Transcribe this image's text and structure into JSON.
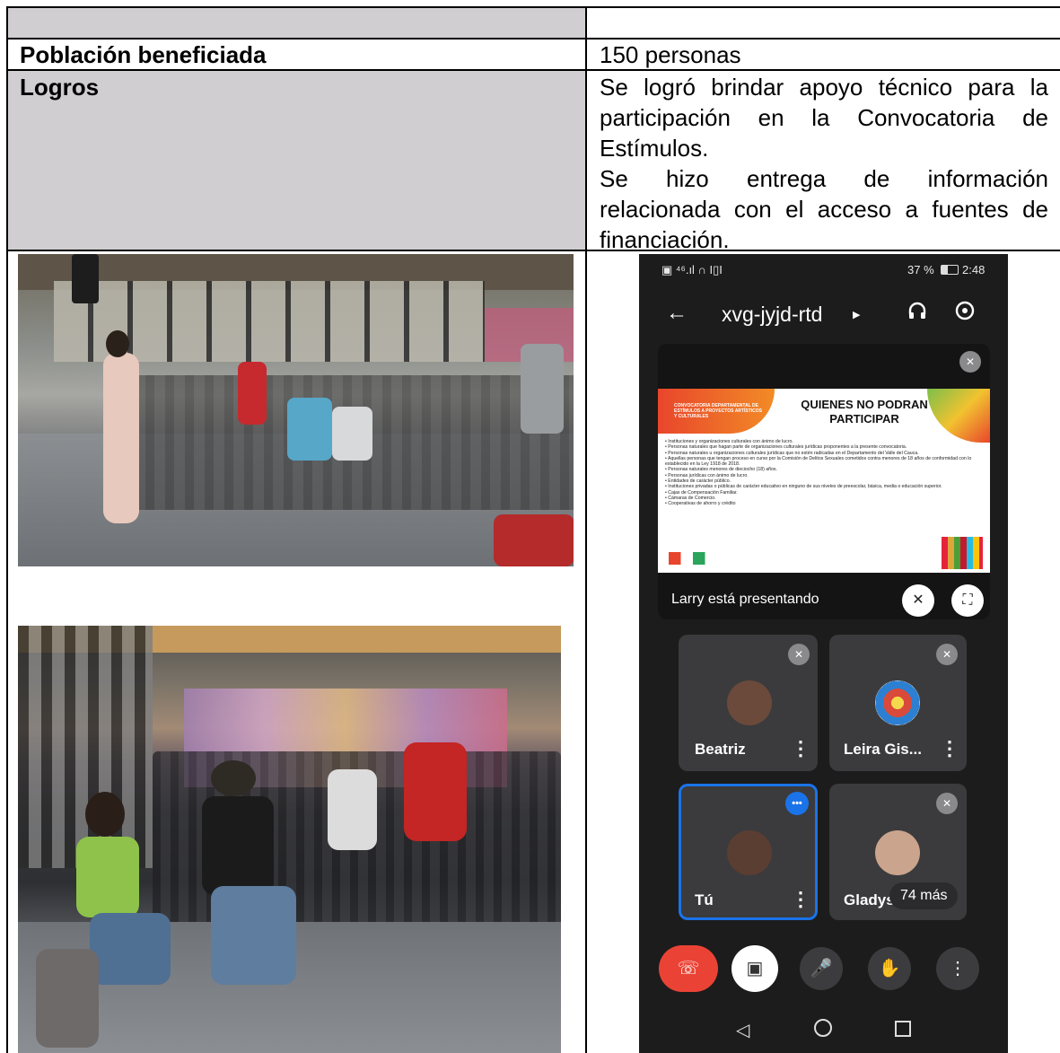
{
  "table": {
    "row1": {
      "label": "Población beneficiada",
      "value": "150 personas"
    },
    "row2": {
      "label": "Logros",
      "paragraph1": "Se logró brindar apoyo técnico para la participación en la Convocatoria de Estímulos.",
      "paragraph2": "Se hizo entrega de información relacionada con el acceso a fuentes de financiación."
    },
    "header_fill_color": "#d0ced0"
  },
  "meet_screenshot": {
    "status_bar": {
      "left": "▣ ⁴⁶.ıl ∩ I▯I",
      "battery": "37 %",
      "time": "2:48"
    },
    "meeting_code": "xvg-jyjd-rtd",
    "slide": {
      "header": "CONVOCATORIA DEPARTAMENTAL DE ESTÍMULOS A PROYECTOS ARTÍSTICOS Y CULTURALES",
      "title": "QUIENES NO PODRAN PARTICIPAR",
      "items": [
        "Instituciones y organizaciones culturales con ánimo de lucro.",
        "Personas naturales que hagan parte de organizaciones culturales jurídicas proponentes a la presente convocatoria.",
        "Personas naturales u organizaciones culturales jurídicas que no estén radicadas en el Departamento del Valle del Cauca.",
        "Aquellas personas que tengan proceso en curso por la Comisión de Delitos Sexuales cometidos contra menores de 18 años de conformidad con lo establecido en la Ley 1918 de 2018.",
        "Personas naturales menores de dieciocho (18) años.",
        "Personas jurídicas con ánimo de lucro.",
        "Entidades de carácter público.",
        "Instituciones privadas o públicas de carácter educativo en ninguno de sus niveles de preescolar, básica, media o educación superior.",
        "Cajas de Compensación Familiar.",
        "Cámaras de Comercio.",
        "Cooperativas de ahorro y crédito"
      ]
    },
    "presenting_text": "Larry está presentando",
    "participants": [
      {
        "name": "Beatriz",
        "muted": true,
        "avatar_color": "#6b4a3b"
      },
      {
        "name": "Leira Gis...",
        "muted": true,
        "avatar_color": "#d94a3a"
      },
      {
        "name": "Tú",
        "muted": false,
        "speaking": true,
        "avatar_color": "#5a3e31"
      },
      {
        "name": "Gladys",
        "muted": true,
        "avatar_color": "#caa48c"
      }
    ],
    "more_badge": "74 más",
    "accent_blue": "#1a73e8",
    "end_call_red": "#ea4335"
  }
}
